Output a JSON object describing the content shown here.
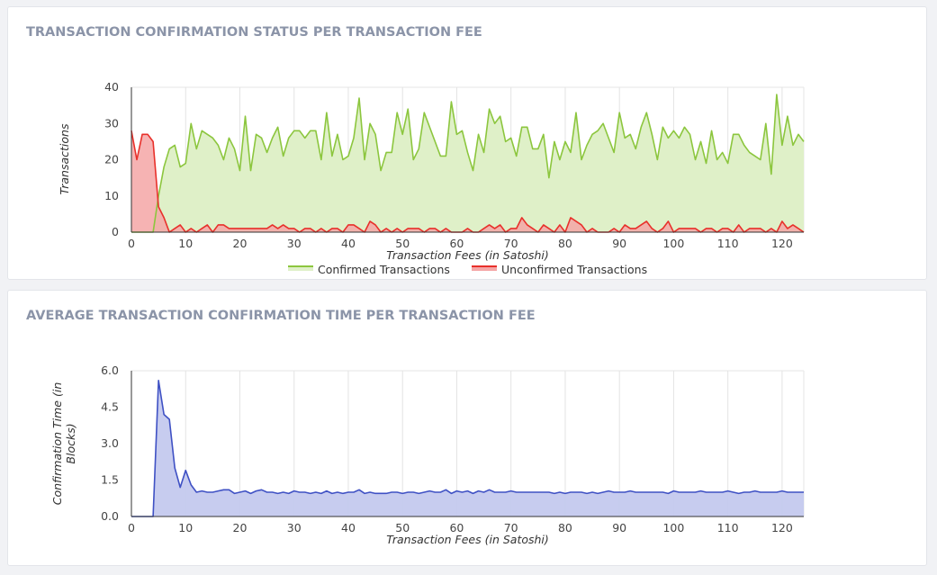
{
  "cards": {
    "status_title": "TRANSACTION CONFIRMATION STATUS PER TRANSACTION FEE",
    "time_title": "AVERAGE TRANSACTION CONFIRMATION TIME PER TRANSACTION FEE"
  },
  "colors": {
    "confirmed_line": "#8cc63e",
    "confirmed_fill": "#dff0c8",
    "unconfirmed_line": "#e8302a",
    "unconfirmed_fill": "#f5a6a6",
    "time_line": "#3f51c4",
    "time_fill": "#c4c9ee"
  },
  "chart_data": [
    {
      "type": "area",
      "title": "TRANSACTION CONFIRMATION STATUS PER TRANSACTION FEE",
      "xlabel": "Transaction Fees (in Satoshi)",
      "ylabel": "Transactions",
      "xlim": [
        0,
        124
      ],
      "ylim": [
        0,
        40
      ],
      "x_ticks": [
        "0",
        "10",
        "20",
        "30",
        "40",
        "50",
        "60",
        "70",
        "80",
        "90",
        "100",
        "110",
        "120"
      ],
      "y_ticks": [
        "0",
        "10",
        "20",
        "30",
        "40"
      ],
      "grid": "vertical",
      "legend": "bottom",
      "series": [
        {
          "name": "Confirmed Transactions",
          "x_start": 0,
          "values": [
            0,
            0,
            0,
            0,
            0,
            10,
            18,
            23,
            24,
            18,
            19,
            30,
            23,
            28,
            27,
            26,
            24,
            20,
            26,
            23,
            17,
            32,
            17,
            27,
            26,
            22,
            26,
            29,
            21,
            26,
            28,
            28,
            26,
            28,
            28,
            20,
            33,
            21,
            27,
            20,
            21,
            26,
            37,
            20,
            30,
            27,
            17,
            22,
            22,
            33,
            27,
            34,
            20,
            23,
            33,
            29,
            25,
            21,
            21,
            36,
            27,
            28,
            22,
            17,
            27,
            22,
            34,
            30,
            32,
            25,
            26,
            21,
            29,
            29,
            23,
            23,
            27,
            15,
            25,
            20,
            25,
            22,
            33,
            20,
            24,
            27,
            28,
            30,
            26,
            22,
            33,
            26,
            27,
            23,
            29,
            33,
            27,
            20,
            29,
            26,
            28,
            26,
            29,
            27,
            20,
            25,
            19,
            28,
            20,
            22,
            19,
            27,
            27,
            24,
            22,
            21,
            20,
            30,
            16,
            38,
            24,
            32,
            24,
            27,
            25
          ]
        },
        {
          "name": "Unconfirmed Transactions",
          "x_start": 0,
          "values": [
            28,
            20,
            27,
            27,
            25,
            7,
            4,
            0,
            1,
            2,
            0,
            1,
            0,
            1,
            2,
            0,
            2,
            2,
            1,
            1,
            1,
            1,
            1,
            1,
            1,
            1,
            2,
            1,
            2,
            1,
            1,
            0,
            1,
            1,
            0,
            1,
            0,
            1,
            1,
            0,
            2,
            2,
            1,
            0,
            3,
            2,
            0,
            1,
            0,
            1,
            0,
            1,
            1,
            1,
            0,
            1,
            1,
            0,
            1,
            0,
            0,
            0,
            1,
            0,
            0,
            1,
            2,
            1,
            2,
            0,
            1,
            1,
            4,
            2,
            1,
            0,
            2,
            1,
            0,
            2,
            0,
            4,
            3,
            2,
            0,
            1,
            0,
            0,
            0,
            1,
            0,
            2,
            1,
            1,
            2,
            3,
            1,
            0,
            1,
            3,
            0,
            1,
            1,
            1,
            1,
            0,
            1,
            1,
            0,
            1,
            1,
            0,
            2,
            0,
            1,
            1,
            1,
            0,
            1,
            0,
            3,
            1,
            2,
            1,
            0
          ]
        }
      ]
    },
    {
      "type": "area",
      "title": "AVERAGE TRANSACTION CONFIRMATION TIME PER TRANSACTION FEE",
      "xlabel": "Transaction Fees (in Satoshi)",
      "ylabel": "Confirmation Time (in Blocks)",
      "xlim": [
        0,
        124
      ],
      "ylim": [
        0,
        6
      ],
      "x_ticks": [
        "0",
        "10",
        "20",
        "30",
        "40",
        "50",
        "60",
        "70",
        "80",
        "90",
        "100",
        "110",
        "120"
      ],
      "y_ticks": [
        "0.0",
        "1.5",
        "3.0",
        "4.5",
        "6.0"
      ],
      "grid": "vertical",
      "legend": "none",
      "series": [
        {
          "x_start": 0,
          "values": [
            0,
            0,
            0,
            0,
            0,
            5.6,
            4.2,
            4.0,
            2.0,
            1.2,
            1.9,
            1.3,
            1.0,
            1.05,
            1.0,
            1.0,
            1.05,
            1.1,
            1.1,
            0.95,
            1.0,
            1.05,
            0.95,
            1.05,
            1.1,
            1.0,
            1.0,
            0.95,
            1.0,
            0.95,
            1.05,
            1.0,
            1.0,
            0.95,
            1.0,
            0.95,
            1.05,
            0.95,
            1.0,
            0.95,
            1.0,
            1.0,
            1.1,
            0.95,
            1.0,
            0.95,
            0.95,
            0.95,
            1.0,
            1.0,
            0.95,
            1.0,
            1.0,
            0.95,
            1.0,
            1.05,
            1.0,
            1.0,
            1.1,
            0.95,
            1.05,
            1.0,
            1.05,
            0.95,
            1.05,
            1.0,
            1.1,
            1.0,
            1.0,
            1.0,
            1.05,
            1.0,
            1.0,
            1.0,
            1.0,
            1.0,
            1.0,
            1.0,
            0.95,
            1.0,
            0.95,
            1.0,
            1.0,
            1.0,
            0.95,
            1.0,
            0.95,
            1.0,
            1.05,
            1.0,
            1.0,
            1.0,
            1.05,
            1.0,
            1.0,
            1.0,
            1.0,
            1.0,
            1.0,
            0.95,
            1.05,
            1.0,
            1.0,
            1.0,
            1.0,
            1.05,
            1.0,
            1.0,
            1.0,
            1.0,
            1.05,
            1.0,
            0.95,
            1.0,
            1.0,
            1.05,
            1.0,
            1.0,
            1.0,
            1.0,
            1.05,
            1.0,
            1.0,
            1.0,
            1.0
          ]
        }
      ]
    }
  ]
}
